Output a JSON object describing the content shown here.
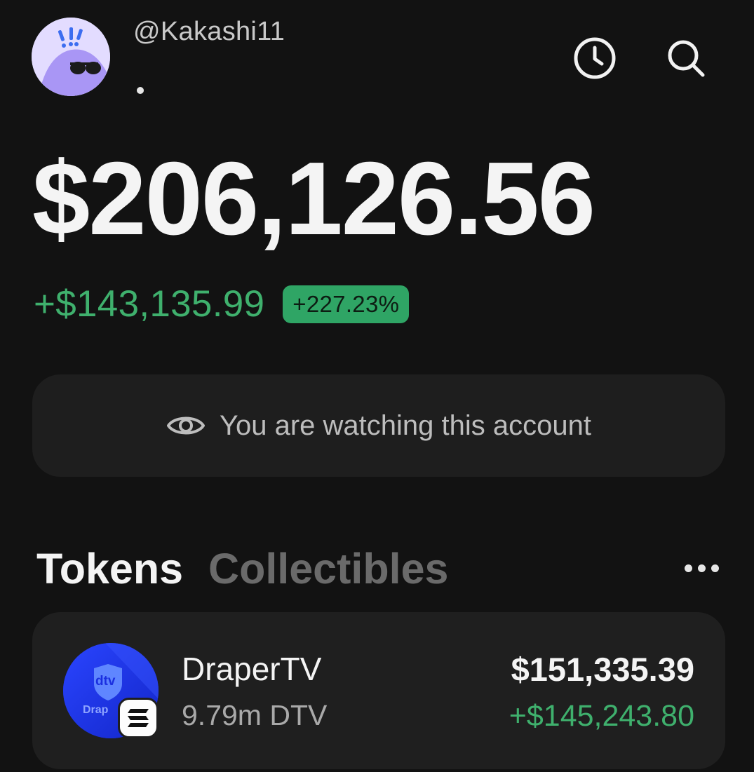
{
  "header": {
    "username": "@Kakashi11",
    "avatar_icon": "mascot-sunglasses-avatar",
    "history_icon": "clock-icon",
    "search_icon": "search-icon"
  },
  "balance": {
    "total": "$206,126.56",
    "change_amount": "+$143,135.99",
    "change_percent": "+227.23%"
  },
  "watch_banner": {
    "icon": "eye-icon",
    "text": "You are watching this account"
  },
  "tabs": [
    {
      "label": "Tokens",
      "active": true
    },
    {
      "label": "Collectibles",
      "active": false
    }
  ],
  "more_icon": "more-horizontal-icon",
  "tokens": [
    {
      "name": "DraperTV",
      "amount": "9.79m DTV",
      "value": "$151,335.39",
      "change": "+$145,243.80",
      "logo_text_top": "dtv",
      "logo_text_bottom": "Drap",
      "chain_icon": "solana-chain-icon"
    }
  ],
  "colors": {
    "background": "#121212",
    "positive": "#3fb06d",
    "badge": "#2fa565",
    "card": "#1f1f1f"
  }
}
